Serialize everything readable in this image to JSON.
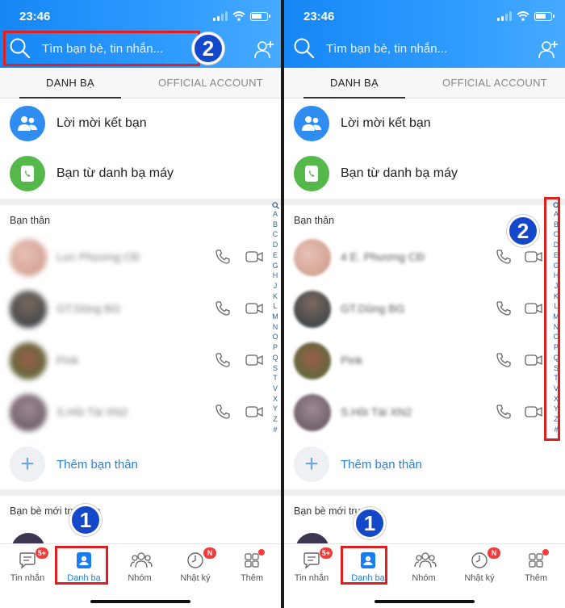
{
  "status": {
    "time": "23:46"
  },
  "search": {
    "placeholder": "Tìm bạn bè, tin nhắn..."
  },
  "tabs": {
    "contacts": "DANH BẠ",
    "official": "OFFICIAL ACCOUNT"
  },
  "specials": {
    "friend_requests": "Lời mời kết bạn",
    "phonebook": "Bạn từ danh bạ máy"
  },
  "close_friends": {
    "title": "Bạn thân",
    "contacts_left": [
      "Lưc Phương CĐ",
      "GT.Dũng BG",
      "Pink",
      "S.Hồi Tài XN2"
    ],
    "contacts_right": [
      "4 E. Phương CĐ",
      "GT.Dũng BG",
      "Pink",
      "S.Hồi Tài XN2"
    ],
    "add_label": "Thêm bạn thân"
  },
  "new_friends": {
    "title_left": "Bạn bè mới truy cập",
    "title_right": "Bạn bè mới tru"
  },
  "index_letters": [
    "A",
    "B",
    "C",
    "D",
    "E",
    "G",
    "H",
    "J",
    "K",
    "L",
    "M",
    "N",
    "O",
    "P",
    "Q",
    "S",
    "T",
    "V",
    "X",
    "Y",
    "Z",
    "#"
  ],
  "nav": {
    "messages": "Tin nhắn",
    "messages_badge": "5+",
    "contacts": "Danh bạ",
    "groups": "Nhóm",
    "timeline": "Nhật ký",
    "timeline_badge": "N",
    "more": "Thêm"
  },
  "callouts": {
    "step1": "1",
    "step2": "2"
  },
  "colors": {
    "header_blue": "#1587f5",
    "highlight_red": "#e02020",
    "callout_blue": "#1447c9"
  }
}
